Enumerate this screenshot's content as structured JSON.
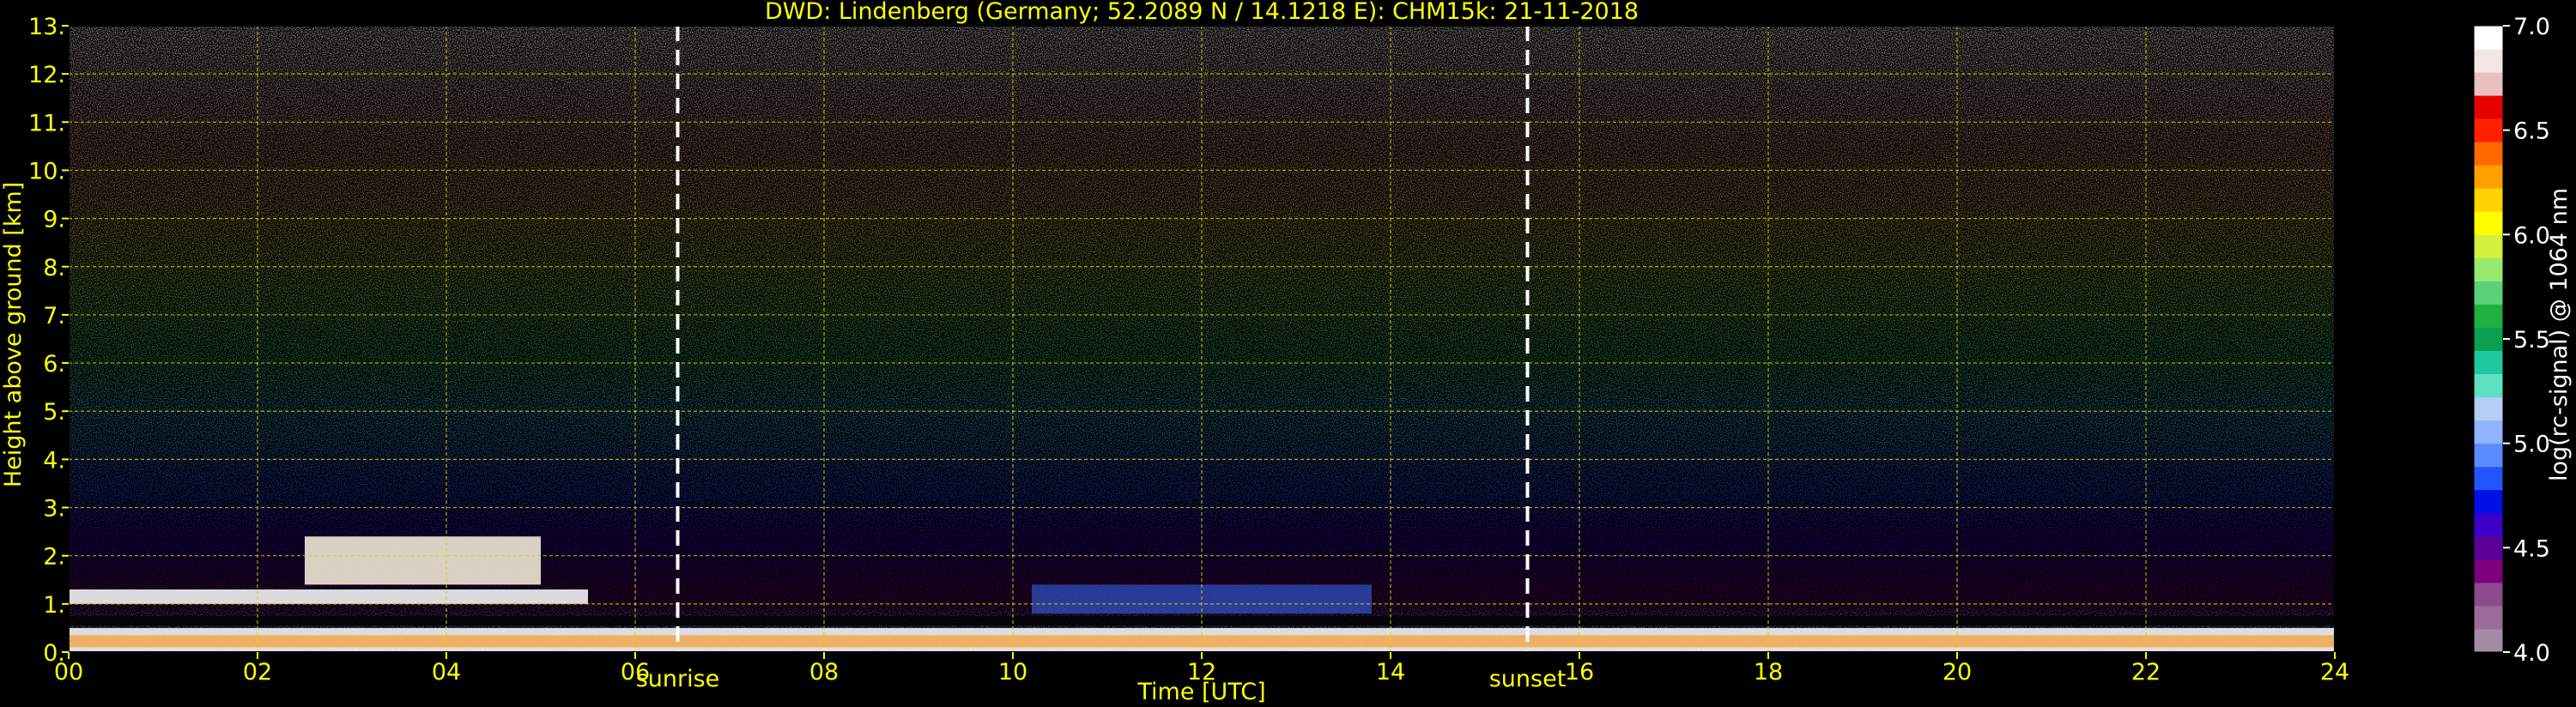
{
  "chart_data": {
    "type": "heatmap",
    "title": "DWD: Lindenberg (Germany; 52.2089 N / 14.1218 E):    CHM15k: 21-11-2018",
    "xlabel": "Time [UTC]",
    "ylabel": "Height above ground [km]",
    "xlim": [
      0,
      24
    ],
    "ylim": [
      0,
      13
    ],
    "x_ticks": [
      0,
      2,
      4,
      6,
      8,
      10,
      12,
      14,
      16,
      18,
      20,
      22,
      24
    ],
    "x_tick_labels": [
      "00",
      "02",
      "04",
      "06",
      "08",
      "10",
      "12",
      "14",
      "16",
      "18",
      "20",
      "22",
      "24"
    ],
    "y_ticks": [
      0,
      1,
      2,
      3,
      4,
      5,
      6,
      7,
      8,
      9,
      10,
      11,
      12,
      13
    ],
    "y_tick_labels": [
      "0.",
      "1.",
      "2.",
      "3.",
      "4.",
      "5.",
      "6.",
      "7.",
      "8.",
      "9.",
      "10.",
      "11.",
      "12.",
      "13."
    ],
    "grid": true,
    "grid_color": "#d4d400",
    "annotations": [
      {
        "text": "sunrise",
        "x": 6.45
      },
      {
        "text": "sunset",
        "x": 15.45
      }
    ],
    "colorbar": {
      "label": "log(rc-signal) @ 1064 nm",
      "range": [
        4.0,
        7.0
      ],
      "ticks": [
        4.0,
        4.5,
        5.0,
        5.5,
        6.0,
        6.5,
        7.0
      ],
      "tick_labels": [
        "4.0",
        "4.5",
        "5.0",
        "5.5",
        "6.0",
        "6.5",
        "7.0"
      ],
      "colors": [
        "#a58ca5",
        "#9a6c9a",
        "#8d4a8d",
        "#7d007d",
        "#5a0099",
        "#3a00c8",
        "#0010e6",
        "#2255ff",
        "#5b8cff",
        "#90b4ff",
        "#b6cdf5",
        "#5fe0c0",
        "#20c8a0",
        "#0aa050",
        "#20b040",
        "#5ad27a",
        "#96eb6e",
        "#d2f03c",
        "#ffff00",
        "#ffd200",
        "#ffa000",
        "#ff6a00",
        "#ff2000",
        "#e60000",
        "#e8c0c0",
        "#f5e6e6",
        "#ffffff"
      ]
    },
    "features": [
      {
        "kind": "boundary layer (strong backscatter)",
        "x_range": [
          0,
          24
        ],
        "height_km": [
          0.0,
          0.5
        ]
      },
      {
        "kind": "low cloud layer",
        "x_range": [
          0,
          5.5
        ],
        "height_km": [
          1.0,
          1.3
        ]
      },
      {
        "kind": "cloud patches",
        "x_range": [
          2.5,
          5.0
        ],
        "height_km": [
          1.4,
          2.4
        ]
      },
      {
        "kind": "elevated aerosol layer",
        "x_range": [
          10.2,
          13.8
        ],
        "height_km": [
          0.8,
          1.4
        ]
      }
    ]
  }
}
